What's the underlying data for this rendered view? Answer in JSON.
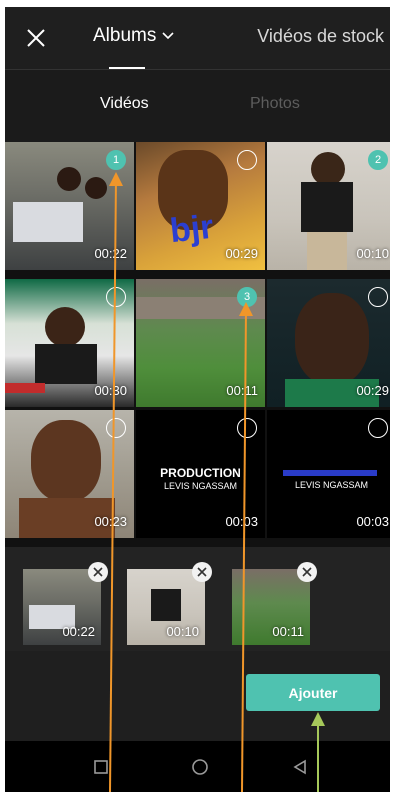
{
  "header": {
    "albums_label": "Albums",
    "stock_label": "Vidéos de stock"
  },
  "subtabs": {
    "videos": "Vidéos",
    "photos": "Photos"
  },
  "grid": {
    "items": [
      {
        "duration": "00:22",
        "selected": "1"
      },
      {
        "duration": "00:29",
        "selected": "",
        "overlay": "bjr"
      },
      {
        "duration": "00:10",
        "selected": "2"
      },
      {
        "duration": "00:30",
        "selected": ""
      },
      {
        "duration": "00:11",
        "selected": "3"
      },
      {
        "duration": "00:29",
        "selected": ""
      },
      {
        "duration": "00:23",
        "selected": ""
      },
      {
        "duration": "00:03",
        "selected": "",
        "title": "PRODUCTION",
        "subtitle": "LEVIS NGASSAM"
      },
      {
        "duration": "00:03",
        "selected": "",
        "subtitle": "LEVIS NGASSAM"
      }
    ]
  },
  "selection": {
    "items": [
      {
        "duration": "00:22"
      },
      {
        "duration": "00:10"
      },
      {
        "duration": "00:11"
      }
    ]
  },
  "actions": {
    "add_label": "Ajouter"
  },
  "colors": {
    "accent": "#4fc2b0",
    "annotation_orange": "#f0962a",
    "annotation_green": "#a6c85a"
  }
}
